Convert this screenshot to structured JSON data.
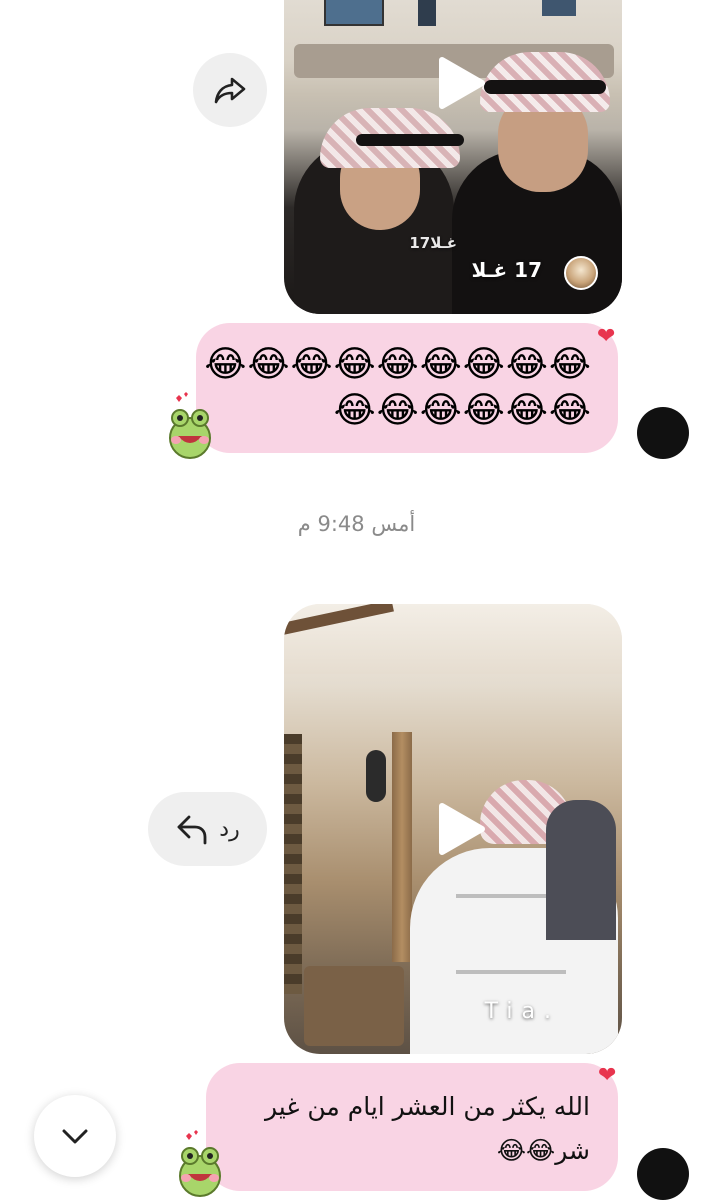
{
  "messages": [
    {
      "type": "video",
      "overlay_caption_small": "غـلا17",
      "overlay_caption_handle": "17 غـلا",
      "reaction": "heart"
    },
    {
      "type": "text",
      "emoji_line_1": "😂😂😂😂😂😂😂😂😂",
      "emoji_line_2": "😂😂😂😂😂😂",
      "reaction": "heart",
      "sticker": "frog-sticker"
    },
    {
      "type": "video",
      "overlay_watermark": "Tia.",
      "reaction": "none"
    },
    {
      "type": "text",
      "text": "الله يكثر من العشر ايام من غير شر😂😂",
      "reaction": "heart",
      "sticker": "frog-sticker"
    }
  ],
  "timestamp": "أمس 9:48 م",
  "actions": {
    "share_icon": "share-icon",
    "reply_label": "رد",
    "reply_icon": "reply-arrow-icon",
    "scroll_down_icon": "chevron-down-icon"
  },
  "colors": {
    "bubble": "#f9d4e4",
    "reaction_heart": "#e8344e",
    "timestamp": "#8a8a8a",
    "action_bg": "#efefef"
  }
}
